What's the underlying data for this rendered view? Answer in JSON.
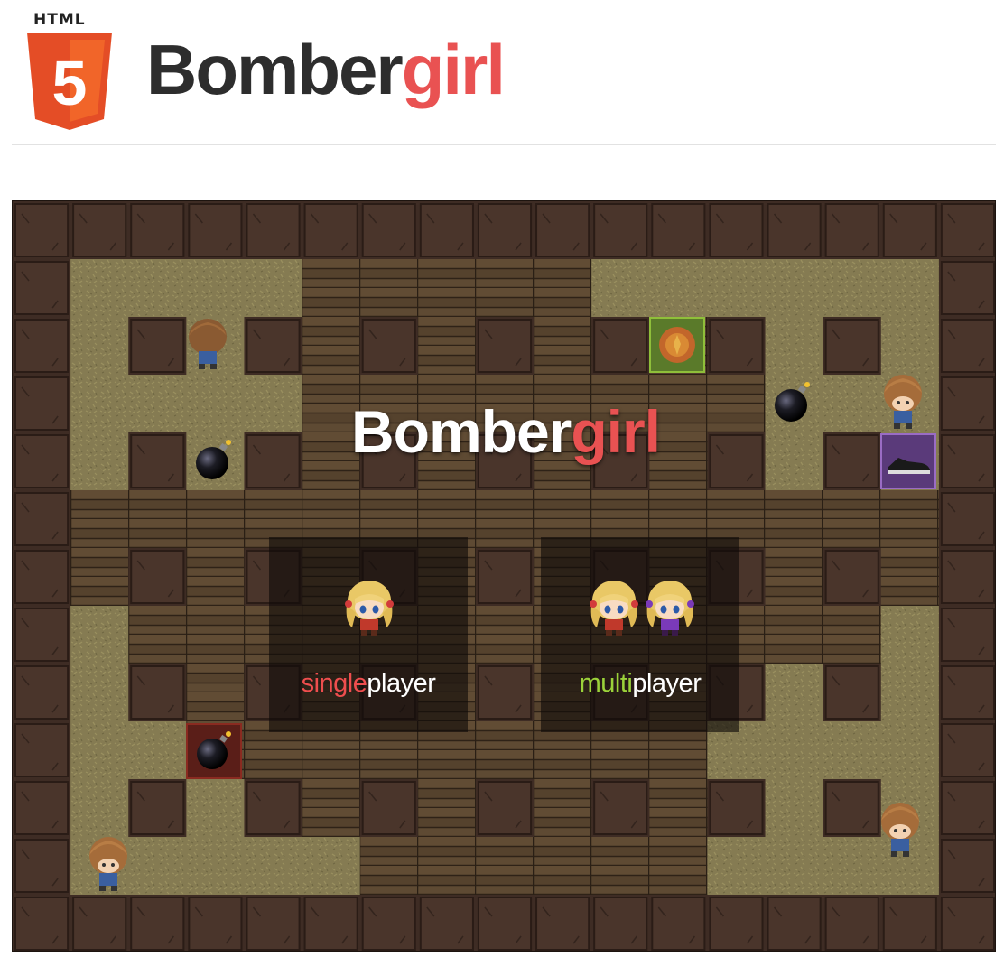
{
  "header": {
    "logo_caption": "HTML",
    "logo_numeral": "5",
    "title_main": "Bomber",
    "title_accent": "girl"
  },
  "game": {
    "title_main": "Bomber",
    "title_accent": "girl",
    "menu": {
      "single": {
        "accent": "single",
        "rest": "player"
      },
      "multi": {
        "accent": "multi",
        "rest": "player"
      }
    }
  },
  "colors": {
    "accent_red": "#e95252",
    "accent_green": "#9bd23a",
    "html5_orange": "#e44d26",
    "wall_brown": "#3e2c24",
    "grass": "#857b52",
    "wood_floor": "#5a4630"
  },
  "icons": [
    "html5-logo-icon",
    "bomb-icon",
    "speed-shoe-icon",
    "fire-powerup-icon",
    "girl-sprite",
    "boy-enemy-sprite"
  ]
}
